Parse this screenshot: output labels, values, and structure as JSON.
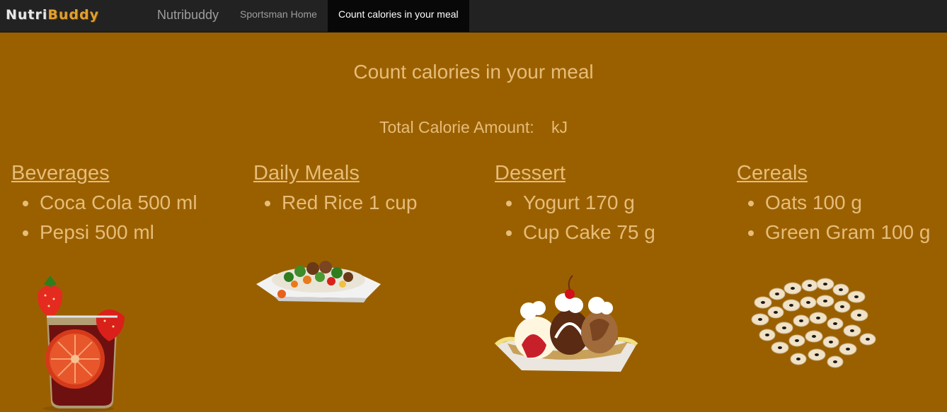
{
  "nav": {
    "logo_part1": "Nutri",
    "logo_part2": "Buddy",
    "brand": "Nutribuddy",
    "links": [
      {
        "label": "Sportsman Home"
      },
      {
        "label": "Count calories in your meal"
      }
    ]
  },
  "main": {
    "title": "Count calories in your meal",
    "total_label": "Total Calorie Amount:",
    "total_value": "",
    "total_unit": "kJ"
  },
  "categories": [
    {
      "title": "Beverages",
      "items": [
        "Coca Cola 500 ml",
        "Pepsi 500 ml"
      ],
      "image": "fruit-punch-drink"
    },
    {
      "title": "Daily Meals",
      "items": [
        "Red Rice 1 cup"
      ],
      "image": "rice-stir-fry-plate"
    },
    {
      "title": "Dessert",
      "items": [
        "Yogurt 170 g",
        "Cup Cake 75 g"
      ],
      "image": "banana-split-sundae"
    },
    {
      "title": "Cereals",
      "items": [
        "Oats 100 g",
        "Green Gram 100 g"
      ],
      "image": "black-eyed-beans"
    }
  ],
  "colors": {
    "background": "#9a6000",
    "navbar": "#222222",
    "text": "#e6bd79",
    "logo_accent": "#e0a030"
  }
}
